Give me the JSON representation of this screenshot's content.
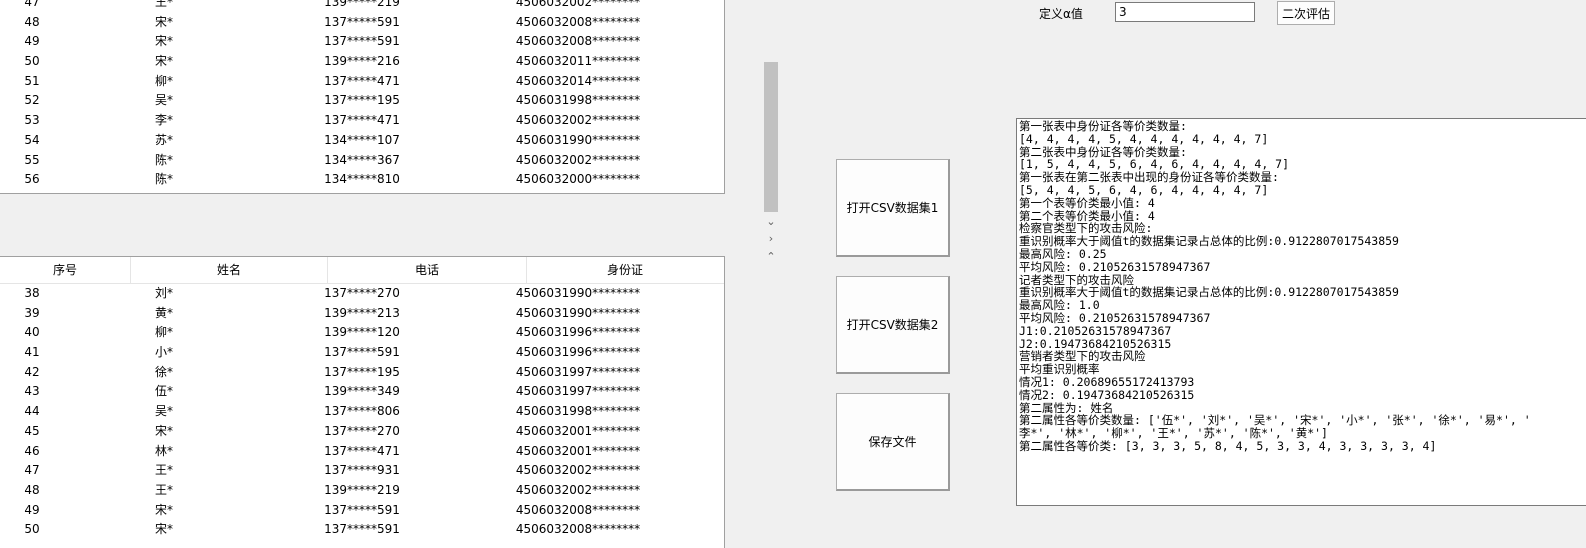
{
  "table1": {
    "rows": [
      [
        "47",
        "王*",
        "139*****219",
        "4506032002********"
      ],
      [
        "48",
        "宋*",
        "137*****591",
        "4506032008********"
      ],
      [
        "49",
        "宋*",
        "137*****591",
        "4506032008********"
      ],
      [
        "50",
        "宋*",
        "139*****216",
        "4506032011********"
      ],
      [
        "51",
        "柳*",
        "137*****471",
        "4506032014********"
      ],
      [
        "52",
        "吴*",
        "137*****195",
        "4506031998********"
      ],
      [
        "53",
        "李*",
        "137*****471",
        "4506032002********"
      ],
      [
        "54",
        "苏*",
        "134*****107",
        "4506031990********"
      ],
      [
        "55",
        "陈*",
        "134*****367",
        "4506032002********"
      ],
      [
        "56",
        "陈*",
        "134*****810",
        "4506032000********"
      ]
    ]
  },
  "table2": {
    "headers": [
      "序号",
      "姓名",
      "电话",
      "身份证"
    ],
    "rows": [
      [
        "38",
        "刘*",
        "137*****270",
        "4506031990********"
      ],
      [
        "39",
        "黄*",
        "139*****213",
        "4506031990********"
      ],
      [
        "40",
        "柳*",
        "139*****120",
        "4506031996********"
      ],
      [
        "41",
        "小*",
        "137*****591",
        "4506031996********"
      ],
      [
        "42",
        "徐*",
        "137*****195",
        "4506031997********"
      ],
      [
        "43",
        "伍*",
        "139*****349",
        "4506031997********"
      ],
      [
        "44",
        "吴*",
        "137*****806",
        "4506031998********"
      ],
      [
        "45",
        "宋*",
        "137*****270",
        "4506032001********"
      ],
      [
        "46",
        "林*",
        "137*****471",
        "4506032001********"
      ],
      [
        "47",
        "王*",
        "137*****931",
        "4506032002********"
      ],
      [
        "48",
        "王*",
        "139*****219",
        "4506032002********"
      ],
      [
        "49",
        "宋*",
        "137*****591",
        "4506032008********"
      ],
      [
        "50",
        "宋*",
        "137*****591",
        "4506032008********"
      ]
    ]
  },
  "alpha": {
    "label": "定义α值",
    "value": "3"
  },
  "buttons": {
    "reevaluate": "二次评估",
    "open_csv1": "打开CSV数据集1",
    "open_csv2": "打开CSV数据集2",
    "save_file": "保存文件"
  },
  "output_lines": [
    "第一张表中身份证各等价类数量:",
    "[4, 4, 4, 4, 5, 4, 4, 4, 4, 4, 4, 7]",
    "第二张表中身份证各等价类数量:",
    "[1, 5, 4, 4, 5, 6, 4, 6, 4, 4, 4, 4, 7]",
    "第一张表在第二张表中出现的身份证各等价类数量:",
    "[5, 4, 4, 5, 6, 4, 6, 4, 4, 4, 4, 7]",
    "第一个表等价类最小值: 4",
    "第二个表等价类最小值: 4",
    "检察官类型下的攻击风险:",
    "重识别概率大于阈值t的数据集记录占总体的比例:0.9122807017543859",
    "最高风险: 0.25",
    "平均风险: 0.21052631578947367",
    "记者类型下的攻击风险",
    "重识别概率大于阈值t的数据集记录占总体的比例:0.9122807017543859",
    "最高风险: 1.0",
    "平均风险: 0.21052631578947367",
    "J1:0.21052631578947367",
    "J2:0.19473684210526315",
    "营销者类型下的攻击风险",
    "平均重识别概率",
    "情况1: 0.20689655172413793",
    "情况2: 0.19473684210526315",
    "第二属性为: 姓名",
    "第二属性各等价类数量: ['伍*', '刘*', '吴*', '宋*', '小*', '张*', '徐*', '易*', '",
    "李*', '林*', '柳*', '王*', '苏*', '陈*', '黄*']",
    "第二属性各等价类: [3, 3, 3, 5, 8, 4, 5, 3, 3, 4, 3, 3, 3, 3, 4]"
  ]
}
